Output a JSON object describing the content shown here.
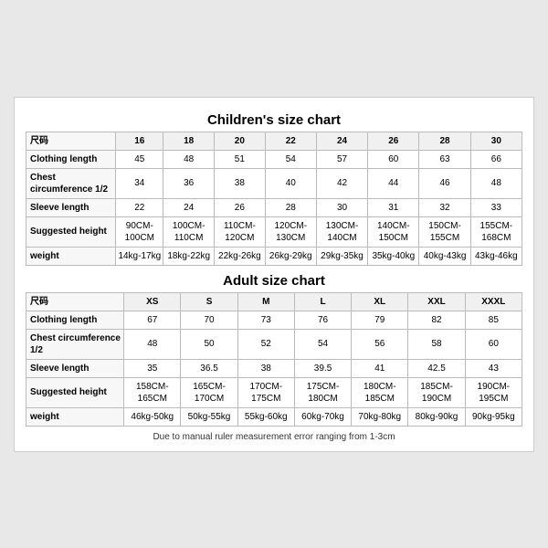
{
  "children_title": "Children's size chart",
  "adult_title": "Adult size chart",
  "note": "Due to manual ruler measurement error ranging from 1-3cm",
  "children": {
    "headers": [
      "尺码",
      "16",
      "18",
      "20",
      "22",
      "24",
      "26",
      "28",
      "30"
    ],
    "rows": [
      {
        "label": "Clothing length",
        "values": [
          "45",
          "48",
          "51",
          "54",
          "57",
          "60",
          "63",
          "66"
        ]
      },
      {
        "label": "Chest circumference 1/2",
        "values": [
          "34",
          "36",
          "38",
          "40",
          "42",
          "44",
          "46",
          "48"
        ]
      },
      {
        "label": "Sleeve length",
        "values": [
          "22",
          "24",
          "26",
          "28",
          "30",
          "31",
          "32",
          "33"
        ]
      },
      {
        "label": "Suggested height",
        "values": [
          "90CM-100CM",
          "100CM-110CM",
          "110CM-120CM",
          "120CM-130CM",
          "130CM-140CM",
          "140CM-150CM",
          "150CM-155CM",
          "155CM-168CM"
        ]
      },
      {
        "label": "weight",
        "values": [
          "14kg-17kg",
          "18kg-22kg",
          "22kg-26kg",
          "26kg-29kg",
          "29kg-35kg",
          "35kg-40kg",
          "40kg-43kg",
          "43kg-46kg"
        ]
      }
    ]
  },
  "adult": {
    "headers": [
      "尺码",
      "XS",
      "S",
      "M",
      "L",
      "XL",
      "XXL",
      "XXXL"
    ],
    "rows": [
      {
        "label": "Clothing length",
        "values": [
          "67",
          "70",
          "73",
          "76",
          "79",
          "82",
          "85"
        ]
      },
      {
        "label": "Chest circumference 1/2",
        "values": [
          "48",
          "50",
          "52",
          "54",
          "56",
          "58",
          "60"
        ]
      },
      {
        "label": "Sleeve length",
        "values": [
          "35",
          "36.5",
          "38",
          "39.5",
          "41",
          "42.5",
          "43"
        ]
      },
      {
        "label": "Suggested height",
        "values": [
          "158CM-165CM",
          "165CM-170CM",
          "170CM-175CM",
          "175CM-180CM",
          "180CM-185CM",
          "185CM-190CM",
          "190CM-195CM"
        ]
      },
      {
        "label": "weight",
        "values": [
          "46kg-50kg",
          "50kg-55kg",
          "55kg-60kg",
          "60kg-70kg",
          "70kg-80kg",
          "80kg-90kg",
          "90kg-95kg"
        ]
      }
    ]
  }
}
